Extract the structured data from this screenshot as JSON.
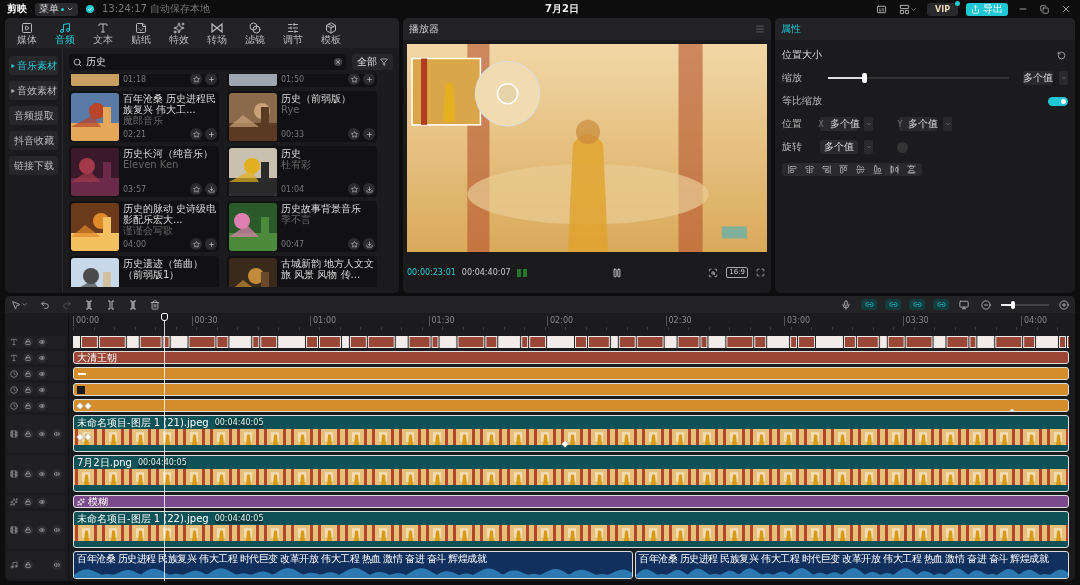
{
  "top_bar": {
    "logo": "剪映",
    "menu": "菜单",
    "autosave": "13:24:17 自动保存本地",
    "title": "7月2日",
    "vip": "VIP",
    "vip_dot": true,
    "export": "导出"
  },
  "media_panel": {
    "tabs": [
      {
        "label": "媒体",
        "selected": false
      },
      {
        "label": "音频",
        "selected": true
      },
      {
        "label": "文本",
        "selected": false
      },
      {
        "label": "贴纸",
        "selected": false
      },
      {
        "label": "特效",
        "selected": false
      },
      {
        "label": "转场",
        "selected": false
      },
      {
        "label": "滤镜",
        "selected": false
      },
      {
        "label": "调节",
        "selected": false
      },
      {
        "label": "模板",
        "selected": false
      }
    ],
    "categories": [
      {
        "label": "音乐素材",
        "selected": true,
        "expandable": true
      },
      {
        "label": "音效素材",
        "selected": false,
        "expandable": true
      },
      {
        "label": "音频提取",
        "selected": false,
        "expandable": false
      },
      {
        "label": "抖音收藏",
        "selected": false,
        "expandable": false
      },
      {
        "label": "链接下载",
        "selected": false,
        "expandable": false
      }
    ],
    "search": {
      "value": "历史"
    },
    "filter": "全部",
    "cards": [
      {
        "duration": "01:18",
        "downloadable": false
      },
      {
        "duration": "01:50",
        "downloadable": false
      },
      {
        "title": "百年沧桑 历史进程民族复兴 伟大工...",
        "artist": "魔郎音乐",
        "duration": "02:21",
        "downloadable": false
      },
      {
        "title": "历史（前弱版）",
        "artist": "Rye",
        "duration": "00:33",
        "downloadable": false
      },
      {
        "title": "历史长河（纯音乐）",
        "artist": "Eleven Ken",
        "duration": "03:57",
        "downloadable": true
      },
      {
        "title": "历史",
        "artist": "杜宥彩",
        "duration": "01:04",
        "downloadable": true
      },
      {
        "title": "历史的脉动 史诗级电影配乐宏大...",
        "artist": "谨谨会写歌",
        "duration": "04:00",
        "downloadable": false
      },
      {
        "title": "历史故事背景音乐",
        "artist": "季不言",
        "duration": "00:47",
        "downloadable": true
      },
      {
        "title": "历史遗迹（笛曲）（前弱版1）"
      },
      {
        "title": "古城新韵 地方人文文旅 风景 风物 传..."
      }
    ]
  },
  "player": {
    "title": "播放器",
    "current_time": "00:00:23:01",
    "total_time": "00:04:40:07",
    "playing": true,
    "aspect": "16:9"
  },
  "properties": {
    "title": "属性",
    "section": "位置大小",
    "scale": {
      "label": "缩放",
      "level": 0.2,
      "value": "多个值"
    },
    "uniform": {
      "label": "等比缩放",
      "on": true
    },
    "position": {
      "label": "位置",
      "x_label": "X",
      "x": "多个值",
      "y_label": "Y",
      "y": "多个值"
    },
    "rotation": {
      "label": "旋转",
      "value": "多个值"
    }
  },
  "timeline": {
    "ruler": [
      "00:00",
      "00:30",
      "01:00",
      "01:30",
      "02:00",
      "02:30",
      "03:00",
      "03:30",
      "04:00"
    ],
    "tracks": [
      {
        "kind": "subtitle"
      },
      {
        "kind": "text",
        "clips": [
          {
            "label": "大清王朝"
          }
        ]
      },
      {
        "kind": "sticker",
        "clips": [
          {
            "kind": "dash"
          }
        ]
      },
      {
        "kind": "sticker",
        "clips": [
          {
            "kind": "square"
          }
        ]
      },
      {
        "kind": "sticker",
        "clips": [
          {
            "keyframes": true
          }
        ]
      },
      {
        "kind": "video",
        "clips": [
          {
            "label": "未命名项目-图层 1 (21).jpeg",
            "duration": "00:04:40:05",
            "keyframes": true
          }
        ]
      },
      {
        "kind": "video",
        "clips": [
          {
            "label": "7月2日.png",
            "duration": "00:04:40:05"
          }
        ]
      },
      {
        "kind": "effect",
        "clips": [
          {
            "label": "模糊"
          }
        ]
      },
      {
        "kind": "video",
        "clips": [
          {
            "label": "未命名项目-图层 1 (22).jpeg",
            "duration": "00:04:40:05"
          }
        ]
      },
      {
        "kind": "audio",
        "clips": [
          {
            "label": "百年沧桑 历史进程 民族复兴 伟大工程 时代巨变 改革开放 伟大工程 热血 激情 奋进 奋斗 辉煌成就"
          },
          {
            "label": "百年沧桑 历史进程 民族复兴 伟大工程 时代巨变 改革开放 伟大工程 热血 激情 奋进 奋斗 辉煌成就"
          }
        ]
      }
    ]
  }
}
